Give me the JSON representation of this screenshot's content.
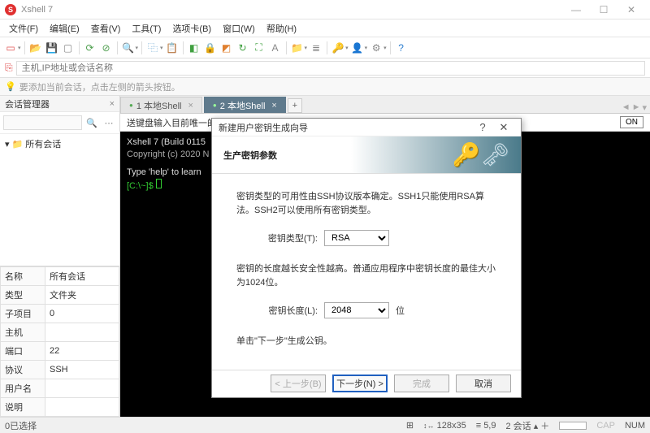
{
  "window": {
    "title": "Xshell 7"
  },
  "menu": [
    "文件(F)",
    "编辑(E)",
    "查看(V)",
    "工具(T)",
    "选项卡(B)",
    "窗口(W)",
    "帮助(H)"
  ],
  "hostbar": {
    "placeholder": "主机,IP地址或会话名称"
  },
  "tipbar": {
    "text": "要添加当前会话，点击左侧的箭头按钮。"
  },
  "sessionPanel": {
    "title": "会话管理器",
    "root": "所有会话"
  },
  "props": [
    {
      "k": "名称",
      "v": "所有会话"
    },
    {
      "k": "类型",
      "v": "文件夹"
    },
    {
      "k": "子项目",
      "v": "0"
    },
    {
      "k": "主机",
      "v": ""
    },
    {
      "k": "端口",
      "v": "22"
    },
    {
      "k": "协议",
      "v": "SSH"
    },
    {
      "k": "用户名",
      "v": ""
    },
    {
      "k": "说明",
      "v": ""
    }
  ],
  "tabs": {
    "tab1": "1 本地Shell",
    "tab2": "2 本地Shell"
  },
  "keyboardTip": {
    "text": "送键盘输入目前唯一的会话。",
    "on": "ON"
  },
  "terminal": {
    "line1": "Xshell 7 (Build 0115",
    "line2": "Copyright (c) 2020 N",
    "line3": "Type 'help' to learn",
    "prompt": "[C:\\~]$ "
  },
  "dialog": {
    "title": "新建用户密钥生成向导",
    "banner": "生产密钥参数",
    "p1": "密钥类型的可用性由SSH协议版本确定。SSH1只能使用RSA算法。SSH2可以使用所有密钥类型。",
    "keyTypeLabel": "密钥类型(T):",
    "keyTypeValue": "RSA",
    "p2": "密钥的长度越长安全性越高。普通应用程序中密钥长度的最佳大小为1024位。",
    "keyLenLabel": "密钥长度(L):",
    "keyLenValue": "2048",
    "keyLenUnit": "位",
    "p3": "单击\"下一步\"生成公钥。",
    "btnPrev": "< 上一步(B)",
    "btnNext": "下一步(N) >",
    "btnFinish": "完成",
    "btnCancel": "取消"
  },
  "status": {
    "left": "0已选择",
    "size": "128x35",
    "pos": "5,9",
    "sess": "2 会话",
    "cap": "CAP",
    "num": "NUM"
  }
}
